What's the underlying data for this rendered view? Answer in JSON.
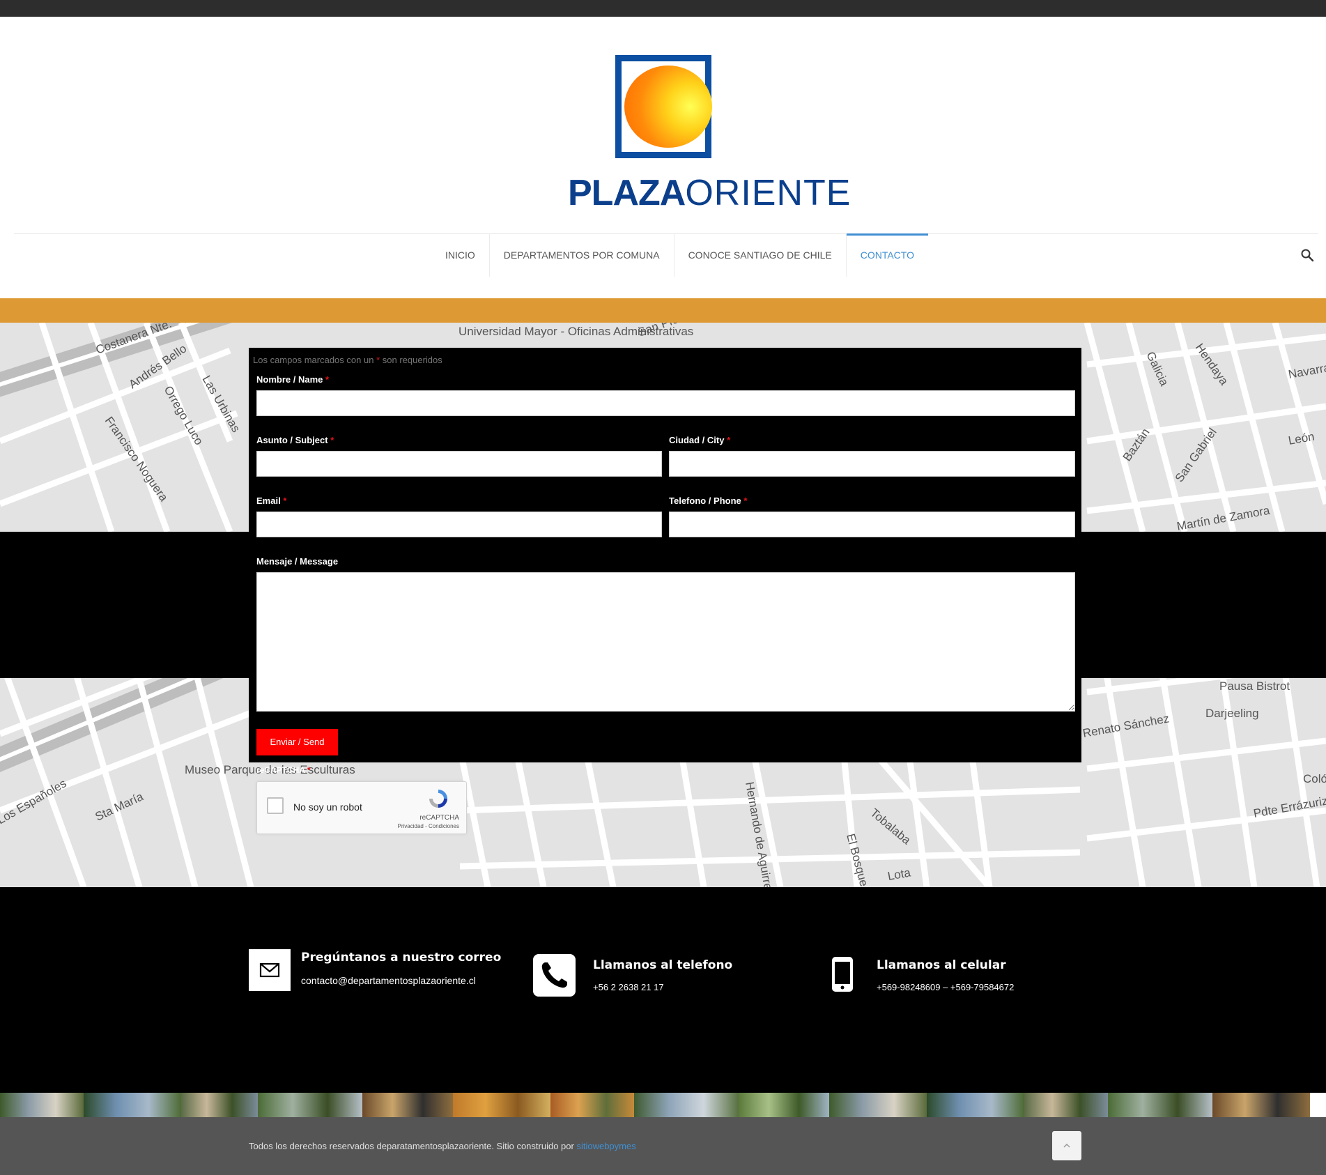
{
  "header": {
    "logo_alt": "PLAZAORIENTE",
    "logo_bold": "PLAZA",
    "logo_light": "ORIENTE"
  },
  "nav": {
    "items": [
      {
        "label": "INICIO",
        "active": false
      },
      {
        "label": "DEPARTAMENTOS POR COMUNA",
        "active": false
      },
      {
        "label": "CONOCE SANTIAGO DE CHILE",
        "active": false
      },
      {
        "label": "CONTACTO",
        "active": true
      }
    ],
    "search_icon": "search-icon"
  },
  "colors": {
    "accent": "#3f8fd2",
    "brand_blue": "#0b3f8c",
    "orange_band": "#dd9933",
    "submit": "#ff0000",
    "footer_bg": "#555555"
  },
  "map": {
    "labels": [
      "Costanera Nte.",
      "Andrés Bello",
      "Orrego Luco",
      "Las Urbinas",
      "Francisco Noguera",
      "Universidad Mayor - Oficinas Administrativas",
      "San Pío X",
      "Galicia",
      "Hendaya",
      "Navarra",
      "León",
      "San Gabriel",
      "Baztán",
      "Martín de Zamora",
      "Pausa Bistrot",
      "Darjeeling",
      "Renato Sánchez",
      "Museo Parque de las Esculturas",
      "Los Españoles",
      "Sta María",
      "Hernando de Aguirre",
      "El Bosque",
      "Tobalaba",
      "Lota",
      "Pdte Errázuriz",
      "Coló"
    ]
  },
  "form": {
    "required_note_prefix": "Los campos marcados con un",
    "required_star": "*",
    "required_note_suffix": "son requeridos",
    "fields": {
      "name_label": "Nombre / Name",
      "subject_label": "Asunto / Subject",
      "city_label": "Ciudad / City",
      "email_label": "Email",
      "phone_label": "Telefono / Phone",
      "message_label": "Mensaje / Message"
    },
    "values": {
      "name": "",
      "subject": "",
      "city": "",
      "email": "",
      "phone": "",
      "message": ""
    },
    "submit_label": "Enviar / Send"
  },
  "recaptcha": {
    "field_label": "reCAPTCHA",
    "checkbox_label": "No soy un robot",
    "brand": "reCAPTCHA",
    "links": "Privacidad - Condiciones"
  },
  "contact": {
    "email": {
      "title": "Pregúntanos a nuestro correo",
      "value": "contacto@departamentosplazaoriente.cl",
      "icon": "envelope-icon"
    },
    "phone": {
      "title": "Llamanos al telefono",
      "value": "+56 2 2638 21 17",
      "icon": "phone-icon"
    },
    "mobile": {
      "title": "Llamanos al celular",
      "value": "+569-98248609 – +569-79584672",
      "icon": "mobile-icon"
    }
  },
  "footer": {
    "copyright_text": "Todos los derechos reservados deparatamentosplazaoriente. Sitio construido por",
    "copyright_link": "sitiowebpymes",
    "back_to_top_icon": "chevron-up-icon"
  }
}
